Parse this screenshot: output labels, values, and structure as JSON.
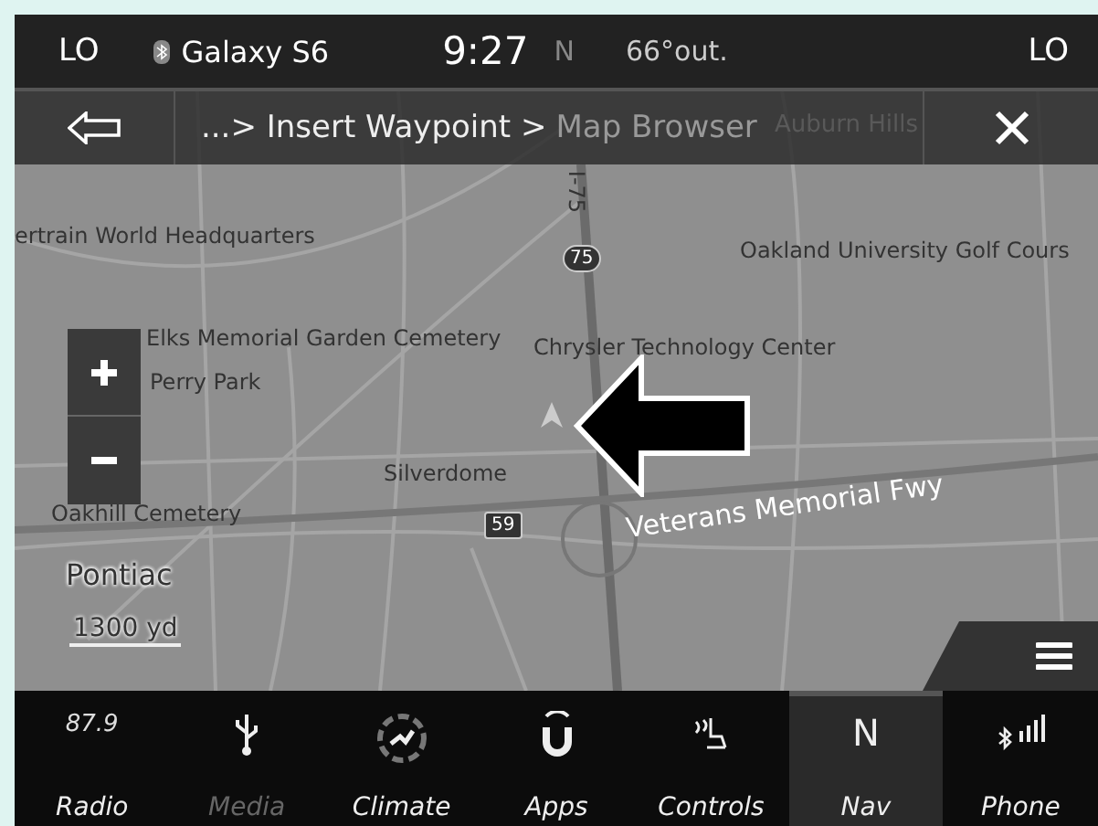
{
  "status_bar": {
    "left_temp": "LO",
    "phone": "Galaxy S6",
    "time": "9:27",
    "heading": "N",
    "outside_temp": "66°out.",
    "right_temp": "LO"
  },
  "breadcrumb": {
    "path": "...> Insert Waypoint >",
    "current": "Map Browser"
  },
  "map": {
    "labels": [
      {
        "text": "Auburn Hills",
        "kind": "faint"
      },
      {
        "text": "ertrain World Headquarters",
        "kind": "place"
      },
      {
        "text": "Oakland University Golf Cours",
        "kind": "place"
      },
      {
        "text": "Elks Memorial Garden Cemetery",
        "kind": "place"
      },
      {
        "text": "Perry Park",
        "kind": "place"
      },
      {
        "text": "Chrysler Technology Center",
        "kind": "place"
      },
      {
        "text": "Silverdome",
        "kind": "place"
      },
      {
        "text": "Oakhill Cemetery",
        "kind": "place"
      },
      {
        "text": "Veterans Memorial Fwy",
        "kind": "road"
      },
      {
        "text": "Pontiac",
        "kind": "city"
      },
      {
        "text": "I-75",
        "kind": "vertical"
      }
    ],
    "shields": [
      {
        "text": "75",
        "kind": "interstate"
      },
      {
        "text": "59",
        "kind": "state"
      }
    ],
    "scale": "1300 yd"
  },
  "nav_bar": [
    {
      "label": "Radio",
      "kind": "radio",
      "value": "87.9",
      "selected": false,
      "disabled": false
    },
    {
      "label": "Media",
      "kind": "usb",
      "selected": false,
      "disabled": true
    },
    {
      "label": "Climate",
      "kind": "climate",
      "selected": false,
      "disabled": false
    },
    {
      "label": "Apps",
      "kind": "apps",
      "selected": false,
      "disabled": false
    },
    {
      "label": "Controls",
      "kind": "controls",
      "selected": false,
      "disabled": false
    },
    {
      "label": "Nav",
      "kind": "nav",
      "value": "N",
      "selected": true,
      "disabled": false
    },
    {
      "label": "Phone",
      "kind": "phone",
      "selected": false,
      "disabled": false
    }
  ]
}
